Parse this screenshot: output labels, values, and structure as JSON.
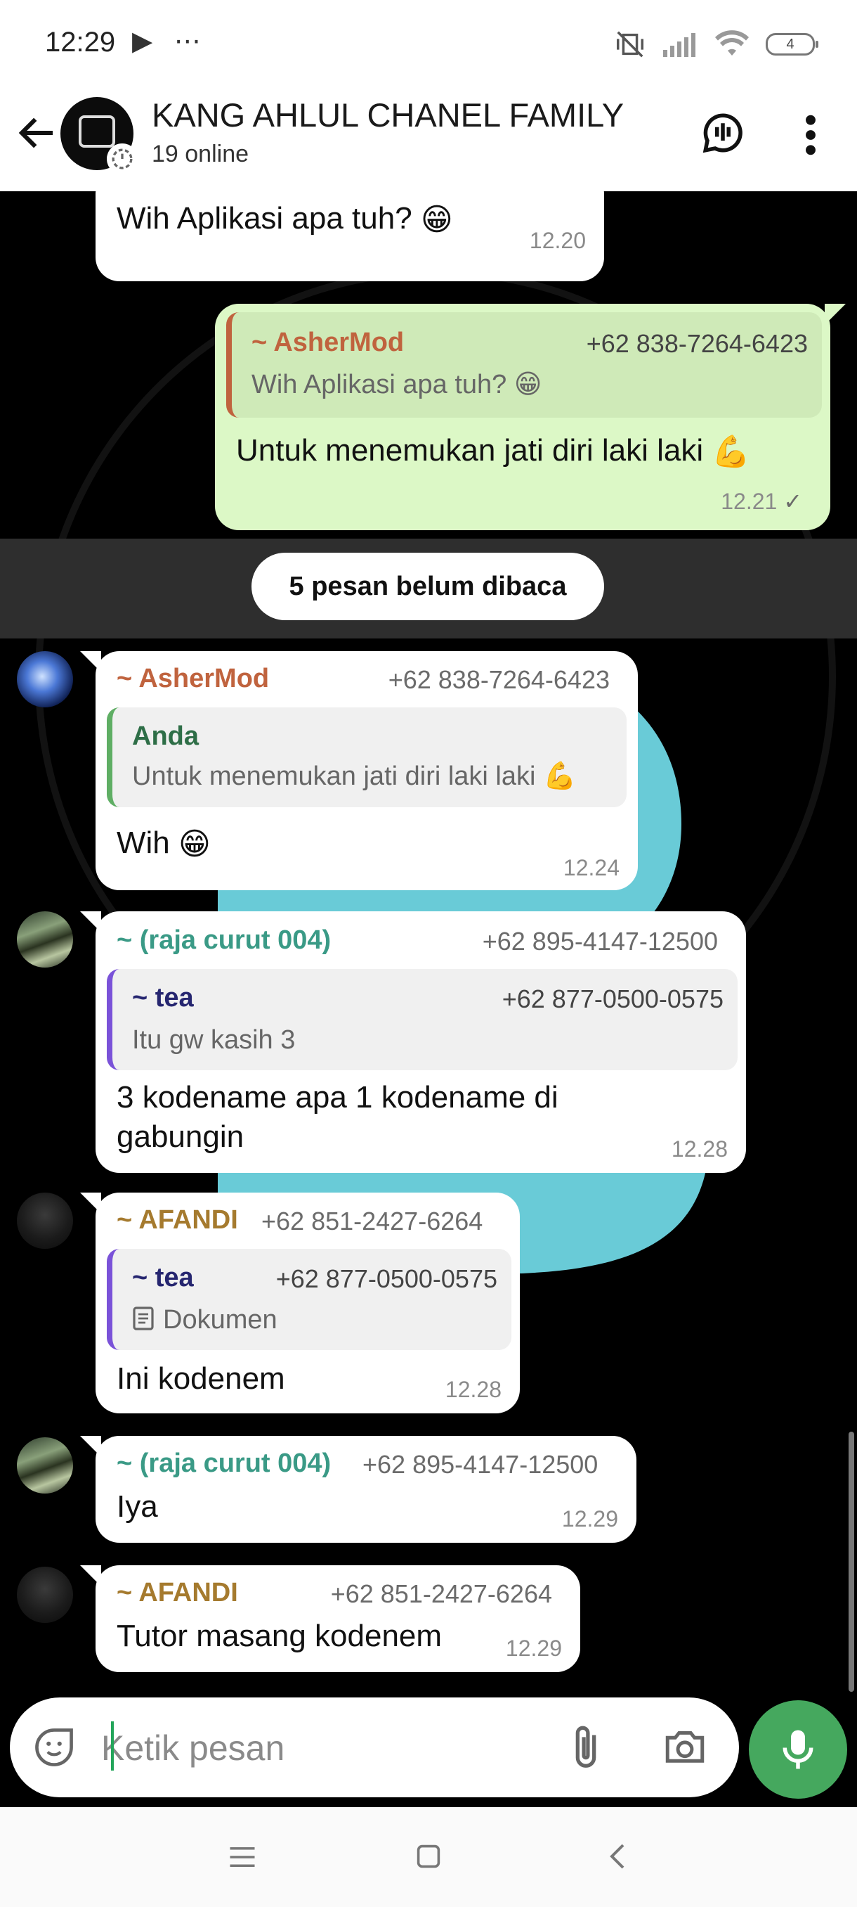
{
  "status_bar": {
    "time": "12:29",
    "left_icons": "▶ ⋯",
    "battery": "4"
  },
  "header": {
    "title": "KANG AHLUL CHANEL FAMILY",
    "subtitle": "19 online"
  },
  "unread_divider": "5 pesan belum dibaca",
  "messages": [
    {
      "text": "Wih Aplikasi apa tuh?",
      "emoji": "😁",
      "time": "12.20"
    },
    {
      "quote_name": "~ AsherMod",
      "quote_phone": "+62 838-7264-6423",
      "quote_text": "Wih Aplikasi apa tuh? 😁",
      "text": "Untuk menemukan jati diri laki laki",
      "emoji": "💪",
      "time": "12.21",
      "status": "✓"
    },
    {
      "sender": "~ AsherMod",
      "phone": "+62 838-7264-6423",
      "quote_name": "Anda",
      "quote_text": "Untuk menemukan jati diri laki laki 💪",
      "text": "Wih",
      "emoji": "😁",
      "time": "12.24"
    },
    {
      "sender": "~ (raja curut 004)",
      "phone": "+62 895-4147-12500",
      "quote_name": "~ tea",
      "quote_phone": "+62 877-0500-0575",
      "quote_text": "Itu gw kasih 3",
      "text_line1": "3 kodename apa 1 kodename di",
      "text_line2": "gabungin",
      "time": "12.28"
    },
    {
      "sender": "~ AFANDI",
      "phone": "+62 851-2427-6264",
      "quote_name": "~ tea",
      "quote_phone": "+62 877-0500-0575",
      "quote_text": "Dokumen",
      "text": "Ini kodenem",
      "time": "12.28"
    },
    {
      "sender": "~ (raja curut 004)",
      "phone": "+62 895-4147-12500",
      "text": "Iya",
      "time": "12.29"
    },
    {
      "sender": "~ AFANDI",
      "phone": "+62 851-2427-6264",
      "text": "Tutor masang kodenem",
      "time": "12.29"
    }
  ],
  "input": {
    "placeholder": "Ketik pesan"
  },
  "colors": {
    "asher": "#c0633e",
    "raja": "#3a9a86",
    "afandi": "#a57a2e",
    "anda": "#2e6e47",
    "tea": "#262670",
    "quote_border_green": "#5fae64",
    "quote_border_purple": "#7a52d8",
    "quote_border_orange": "#c0633e",
    "mic": "#45a85e"
  }
}
